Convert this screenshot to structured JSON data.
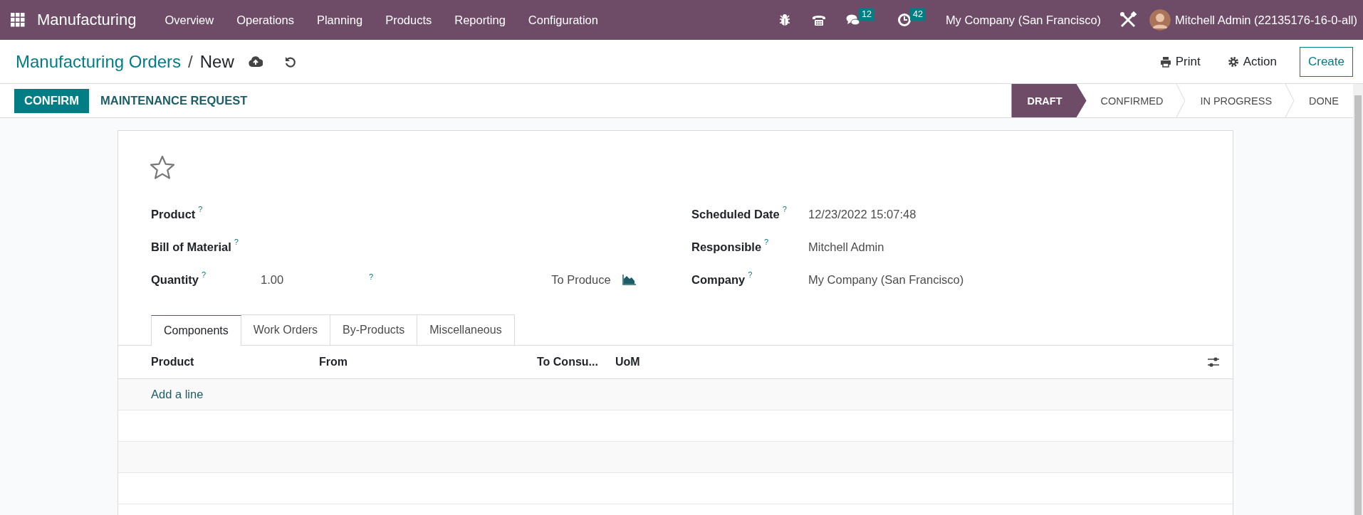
{
  "navbar": {
    "app_name": "Manufacturing",
    "menu": [
      "Overview",
      "Operations",
      "Planning",
      "Products",
      "Reporting",
      "Configuration"
    ],
    "messages_badge": "12",
    "activities_badge": "42",
    "company": "My Company (San Francisco)",
    "user": "Mitchell Admin (22135176-16-0-all)"
  },
  "breadcrumb": {
    "parent": "Manufacturing Orders",
    "separator": "/",
    "current": "New"
  },
  "control_panel": {
    "print": "Print",
    "action": "Action",
    "create": "Create"
  },
  "buttons": [
    {
      "label": "CONFIRM",
      "kind": "primary"
    },
    {
      "label": "MAINTENANCE REQUEST",
      "kind": "secondary"
    }
  ],
  "stages": [
    {
      "label": "DRAFT",
      "selected": true
    },
    {
      "label": "CONFIRMED",
      "selected": false
    },
    {
      "label": "IN PROGRESS",
      "selected": false
    },
    {
      "label": "DONE",
      "selected": false
    }
  ],
  "form": {
    "starred": false,
    "left_fields": [
      {
        "label": "Product",
        "help": "?"
      },
      {
        "label": "Bill of Material",
        "help": "?"
      },
      {
        "label": "Quantity",
        "help": "?",
        "value": "1.00",
        "unit_help": "?",
        "suffix": "To Produce"
      }
    ],
    "right_fields": [
      {
        "label": "Scheduled Date",
        "help": "?",
        "value": "12/23/2022 15:07:48"
      },
      {
        "label": "Responsible",
        "help": "?",
        "value": "Mitchell Admin"
      },
      {
        "label": "Company",
        "help": "?",
        "value": "My Company (San Francisco)"
      }
    ],
    "tabs": [
      {
        "label": "Components",
        "selected": true
      },
      {
        "label": "Work Orders",
        "selected": false
      },
      {
        "label": "By-Products",
        "selected": false
      },
      {
        "label": "Miscellaneous",
        "selected": false
      }
    ],
    "table": {
      "columns": [
        "Product",
        "From",
        "To Consu...",
        "UoM"
      ],
      "add_line": "Add a line"
    }
  }
}
